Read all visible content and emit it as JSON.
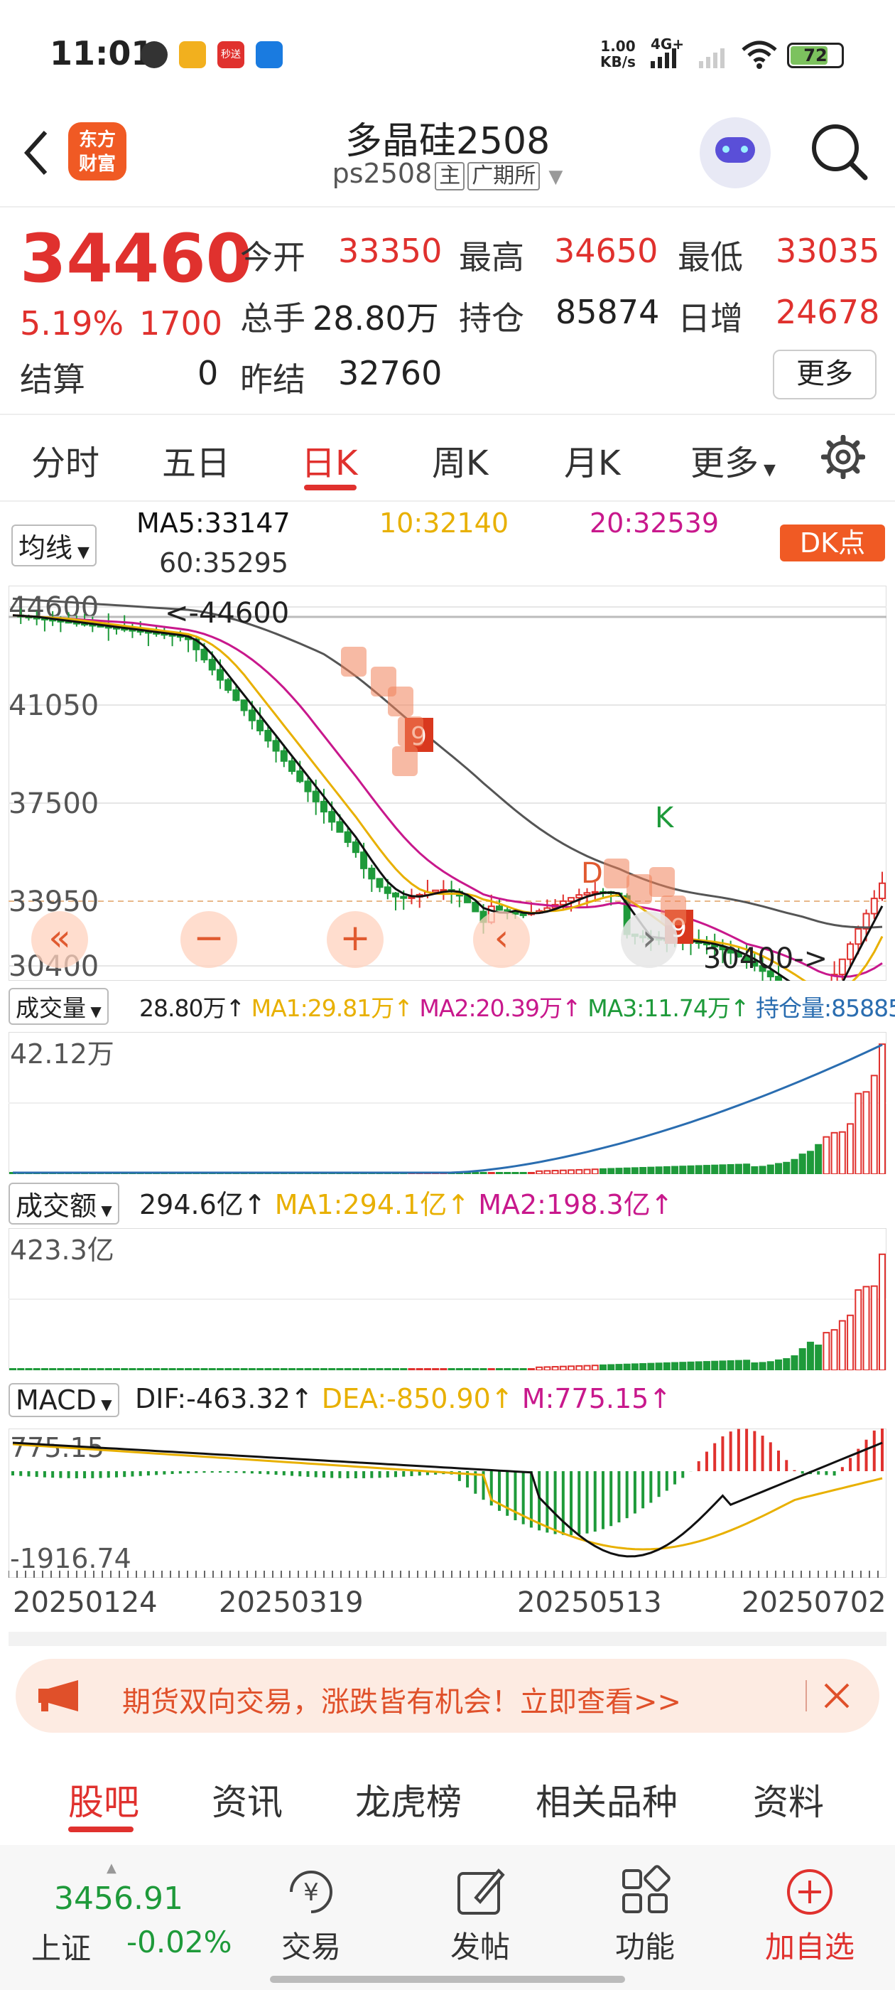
{
  "status_bar": {
    "time": "11:01",
    "net_speed_value": "1.00",
    "net_speed_unit": "KB/s",
    "network": "4G+",
    "battery": "72",
    "app_icons": [
      "wechat-icon",
      "app-icon",
      "miaosong-icon",
      "bird-app-icon"
    ],
    "miaosong_label": "秒送"
  },
  "header": {
    "title": "多晶硅2508",
    "code": "ps2508",
    "tag_main": "主",
    "tag_exchange": "广期所",
    "logo_line1": "东方",
    "logo_line2": "财富"
  },
  "quote": {
    "price": "34460",
    "change_pct": "5.19%",
    "change_abs": "1700",
    "open_label": "今开",
    "open": "33350",
    "high_label": "最高",
    "high": "34650",
    "low_label": "最低",
    "low": "33035",
    "volume_label": "总手",
    "volume": "28.80万",
    "oi_label": "持仓",
    "oi": "85874",
    "daily_inc_label": "日增",
    "daily_inc": "24678",
    "settle_label": "结算",
    "settle": "0",
    "prev_settle_label": "昨结",
    "prev_settle": "32760",
    "more_label": "更多"
  },
  "tabs": [
    "分时",
    "五日",
    "日K",
    "周K",
    "月K",
    "更多"
  ],
  "active_tab": "日K",
  "ma_row": {
    "selector": "均线",
    "ma5": "MA5:33147",
    "ma10": "10:32140",
    "ma20": "20:32539",
    "ma60": "60:35295",
    "dk_label": "DK点"
  },
  "kline": {
    "y_labels": [
      "44600",
      "41050",
      "37500",
      "33950",
      "30400"
    ],
    "max_label": "44600",
    "min_label": "30400",
    "markers": [
      "K",
      "D",
      "9",
      "9"
    ],
    "nav_buttons": [
      "«",
      "−",
      "+",
      "‹",
      "›"
    ],
    "colors": {
      "up": "#e0312e",
      "down": "#1e9a3a",
      "ma5": "#111111",
      "ma10": "#e8b000",
      "ma20": "#c8188c",
      "ma60": "#555555"
    }
  },
  "volume_row": {
    "selector": "成交量",
    "value": "28.80万",
    "ma1": "MA1:29.81万",
    "ma2": "MA2:20.39万",
    "ma3": "MA3:11.74万",
    "oi": "持仓量:85885",
    "y_max": "42.12万"
  },
  "amount_row": {
    "selector": "成交额",
    "value": "294.6亿",
    "ma1": "MA1:294.1亿",
    "ma2": "MA2:198.3亿",
    "y_max": "423.3亿"
  },
  "macd_row": {
    "selector": "MACD",
    "dif": "DIF:-463.32",
    "dea": "DEA:-850.90",
    "m": "M:775.15",
    "y_max": "775.15",
    "y_min": "-1916.74"
  },
  "x_dates": [
    "20250124",
    "20250319",
    "20250513",
    "20250702"
  ],
  "banner": {
    "text": "期货双向交易，涨跌皆有机会！立即查看>>"
  },
  "bottom_tabs": [
    "股吧",
    "资讯",
    "龙虎榜",
    "相关品种",
    "资料"
  ],
  "bottom_nav": {
    "index_value": "3456.91",
    "index_name": "上证",
    "index_change": "-0.02%",
    "items": [
      "交易",
      "发帖",
      "功能",
      "加自选"
    ]
  }
}
